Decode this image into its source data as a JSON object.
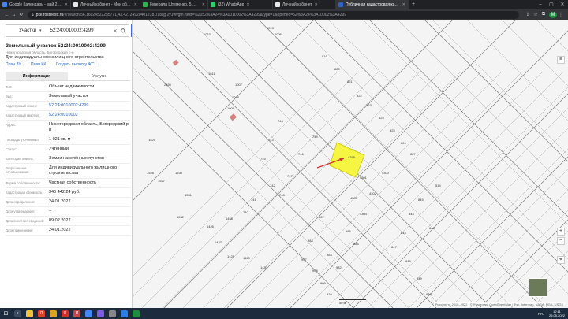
{
  "browser": {
    "tabs": [
      {
        "label": "Google Календарь - май 2022",
        "color": "#4285f4",
        "active": false
      },
      {
        "label": "Личный кабинет - Мои объявл",
        "color": "#e8e8e8",
        "active": false
      },
      {
        "label": "Генерала Штеменко, 5 — 2ГИС",
        "color": "#2fb54a",
        "active": false
      },
      {
        "label": "(32) WhatsApp",
        "color": "#25d366",
        "active": false
      },
      {
        "label": "Личный кабинет",
        "color": "#e8e8e8",
        "active": false
      },
      {
        "label": "Публичная кадастровая карта",
        "color": "#2b63c8",
        "active": true
      }
    ],
    "new_tab": "+",
    "url_host": "pkk.rosreestr.ru",
    "url_rest": "/#/search/56.16024522235771,43.427249204012181/18/@2y1wvgtn?text=%2052%3A24%3A0010002%3A4299&type=1&opened=52%3A24%3A10002%3A4299",
    "avatar_letter": "М"
  },
  "panel": {
    "search_type": "Участки",
    "search_value": "52:24:0010002:4299",
    "title": "Земельный участок 52:24:0010002:4299",
    "address_short": "Нижегородская область, Богородский р-н",
    "purpose": "Для индивидуального жилищного строительства",
    "links": [
      "План ЗУ →",
      "План КК →",
      "Создать выписку ЖС →"
    ],
    "tabs": [
      "Информация",
      "Услуги"
    ],
    "rows": [
      {
        "label": "Тип:",
        "value": "Объект недвижимости",
        "link": false
      },
      {
        "label": "Вид:",
        "value": "Земельный участок",
        "link": false
      },
      {
        "label": "Кадастровый номер:",
        "value": "52:24:0010002:4299",
        "link": true
      },
      {
        "label": "Кадастровый квартал:",
        "value": "52:24:0010002",
        "link": true
      },
      {
        "label": "Адрес:",
        "value": "Нижегородская область, Богородский р-н",
        "link": false
      },
      {
        "label": "Площадь уточненная:",
        "value": "1 021 кв. м",
        "link": false
      },
      {
        "label": "Статус:",
        "value": "Учтенный",
        "link": false
      },
      {
        "label": "Категория земель:",
        "value": "Земли населённых пунктов",
        "link": false
      },
      {
        "label": "Разрешенное использование:",
        "value": "Для индивидуального жилищного строительства",
        "link": false
      },
      {
        "label": "Форма собственности:",
        "value": "Частная собственность",
        "link": false
      },
      {
        "label": "Кадастровая стоимость:",
        "value": "340 442,24 руб.",
        "link": false
      },
      {
        "label": "Дата определения:",
        "value": "24.01.2022",
        "link": false
      },
      {
        "label": "Дата утверждения:",
        "value": "–",
        "link": false
      },
      {
        "label": "Дата внесения сведений:",
        "value": "09.02.2022",
        "link": false
      },
      {
        "label": "Дата применения:",
        "value": "24.01.2022",
        "link": false
      }
    ]
  },
  "map": {
    "plot_labels": [
      "1013",
      "1006",
      "819",
      "820",
      "821",
      "822",
      "823",
      "824",
      "825",
      "826",
      "827",
      "1010",
      "1011",
      "1007",
      "1008",
      "1009",
      "744",
      "743",
      "745",
      "746",
      "747",
      "748",
      "749",
      "742",
      "741",
      "740",
      "4299",
      "4300",
      "4301",
      "4302",
      "4303",
      "4304",
      "987",
      "986",
      "985",
      "984",
      "983",
      "982",
      "907",
      "908",
      "909",
      "910",
      "1529",
      "1530",
      "1531",
      "1532",
      "1528",
      "1527",
      "1426",
      "1427",
      "1428",
      "1429",
      "1430",
      "1458",
      "2456",
      "514",
      "843",
      "844",
      "845",
      "846",
      "847",
      "848",
      "849",
      "850"
    ],
    "selected_plot": "4299",
    "zoom_in": "+",
    "zoom_out": "−",
    "scale_label": "50 м",
    "attribution": "Росреестр 2010–2022 | © Участники OpenStreetMap | Esri, Intermap, NASA, NGA, USGS",
    "colors": {
      "selected_fill": "#f5f542",
      "arrow": "#d0302f",
      "building": "#d88080"
    }
  },
  "taskbar": {
    "time": "12:11",
    "date": "25.05.2022",
    "lang": "РУС"
  }
}
